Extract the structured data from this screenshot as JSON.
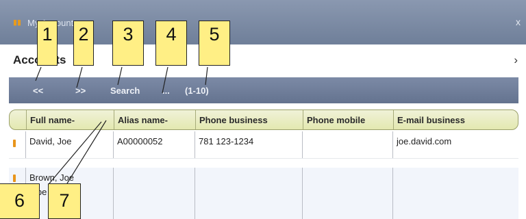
{
  "window": {
    "title": "My Accounts",
    "close_glyph": "x"
  },
  "heading": {
    "title": "Accounts",
    "chevron": "›"
  },
  "toolbar": {
    "prev_label": "<<",
    "next_label": ">>",
    "search_label": "Search",
    "more_label": "...",
    "range_label": "(1-10)"
  },
  "grid": {
    "columns": [
      {
        "label": "Full name",
        "sort_indicator": "-"
      },
      {
        "label": "Alias name",
        "sort_indicator": "-"
      },
      {
        "label": "Phone business",
        "sort_indicator": ""
      },
      {
        "label": "Phone mobile",
        "sort_indicator": ""
      },
      {
        "label": "E-mail business",
        "sort_indicator": ""
      }
    ],
    "rows": [
      {
        "full_name": "David, Joe",
        "alias_name": "A00000052",
        "phone_business": "781 123-1234",
        "phone_mobile": "",
        "email_business": "joe.david.com"
      },
      {
        "full_name": "Brown, Joe",
        "full_name_line2": "...pe",
        "alias_name": "",
        "phone_business": "",
        "phone_mobile": "",
        "email_business": ""
      }
    ]
  },
  "callouts": [
    "1",
    "2",
    "3",
    "4",
    "5",
    "6",
    "7"
  ],
  "colors": {
    "callout_fill": "#ffef85",
    "toolbar": "#6f7e9a",
    "header_highlight": "#e3e8b0",
    "row_icon": "#e8951c"
  },
  "icons": {
    "app": "account-icon",
    "close": "close-icon",
    "row": "account-row-icon"
  }
}
